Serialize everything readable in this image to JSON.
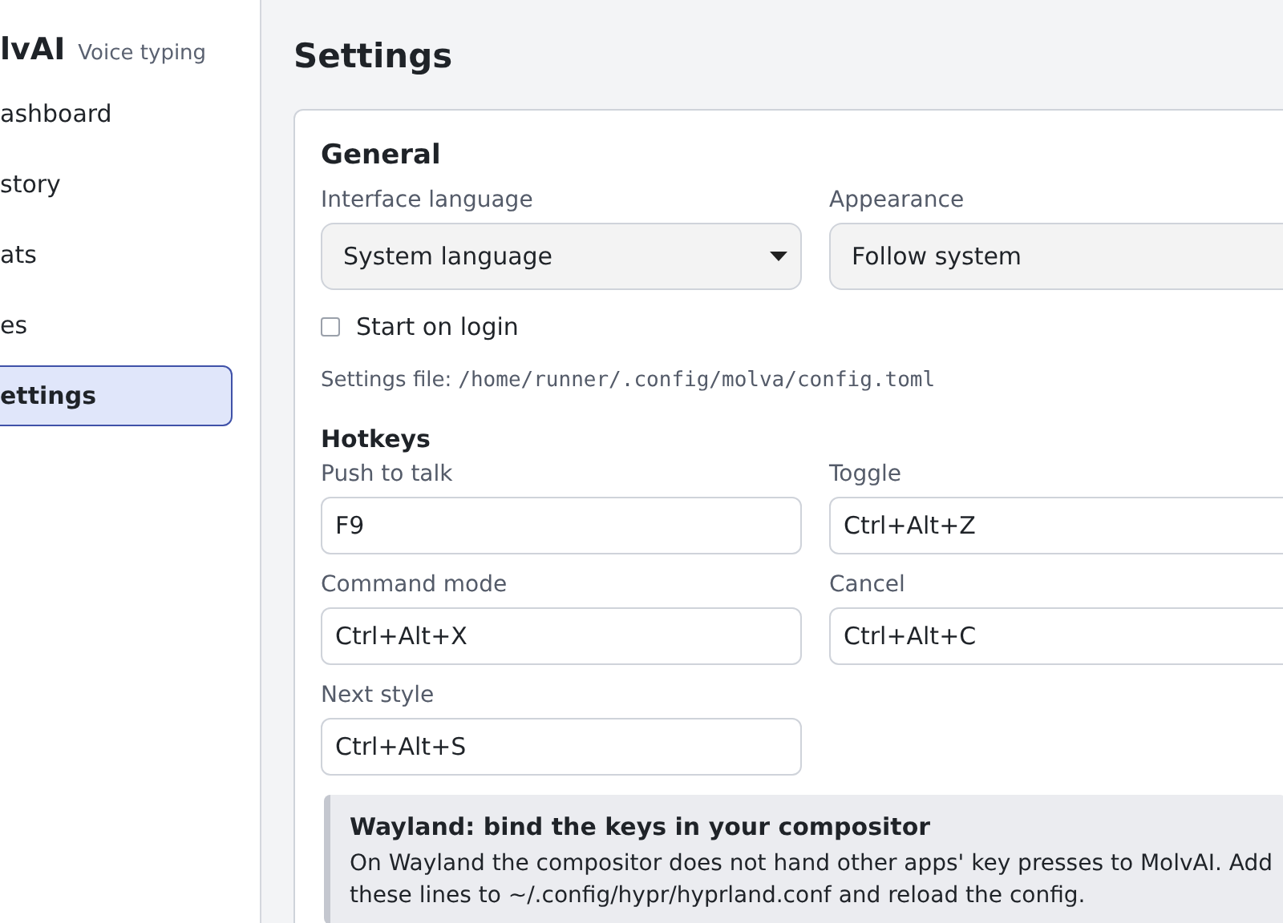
{
  "sidebar": {
    "brand": "lvAI",
    "tagline": "Voice typing",
    "items": [
      {
        "label": "ashboard",
        "selected": false
      },
      {
        "label": "story",
        "selected": false
      },
      {
        "label": "ats",
        "selected": false
      },
      {
        "label": "es",
        "selected": false
      },
      {
        "label": "ettings",
        "selected": true
      }
    ]
  },
  "page_title": "Settings",
  "general": {
    "title": "General",
    "fields": [
      {
        "label": "Interface language",
        "kind": "select",
        "value": "System language"
      },
      {
        "label": "Appearance",
        "kind": "text",
        "value": "Follow system"
      }
    ],
    "start_on_login": {
      "label": "Start on login",
      "checked": false
    },
    "settings_file": {
      "label": "Settings file:",
      "path": "/home/runner/.config/molva/config.toml"
    }
  },
  "hotkeys": {
    "title": "Hotkeys",
    "fields": [
      {
        "label": "Push to talk",
        "value": "F9"
      },
      {
        "label": "Toggle",
        "value": "Ctrl+Alt+Z"
      },
      {
        "label": "Command mode",
        "value": "Ctrl+Alt+X"
      },
      {
        "label": "Cancel",
        "value": "Ctrl+Alt+C"
      },
      {
        "label": "Next style",
        "value": "Ctrl+Alt+S"
      }
    ]
  },
  "notice": {
    "title": "Wayland: bind the keys in your compositor",
    "text": "On Wayland the compositor does not hand other apps' key presses to MolvAI. Add these lines to ~/.config/hypr/hyprland.conf and reload the config."
  }
}
